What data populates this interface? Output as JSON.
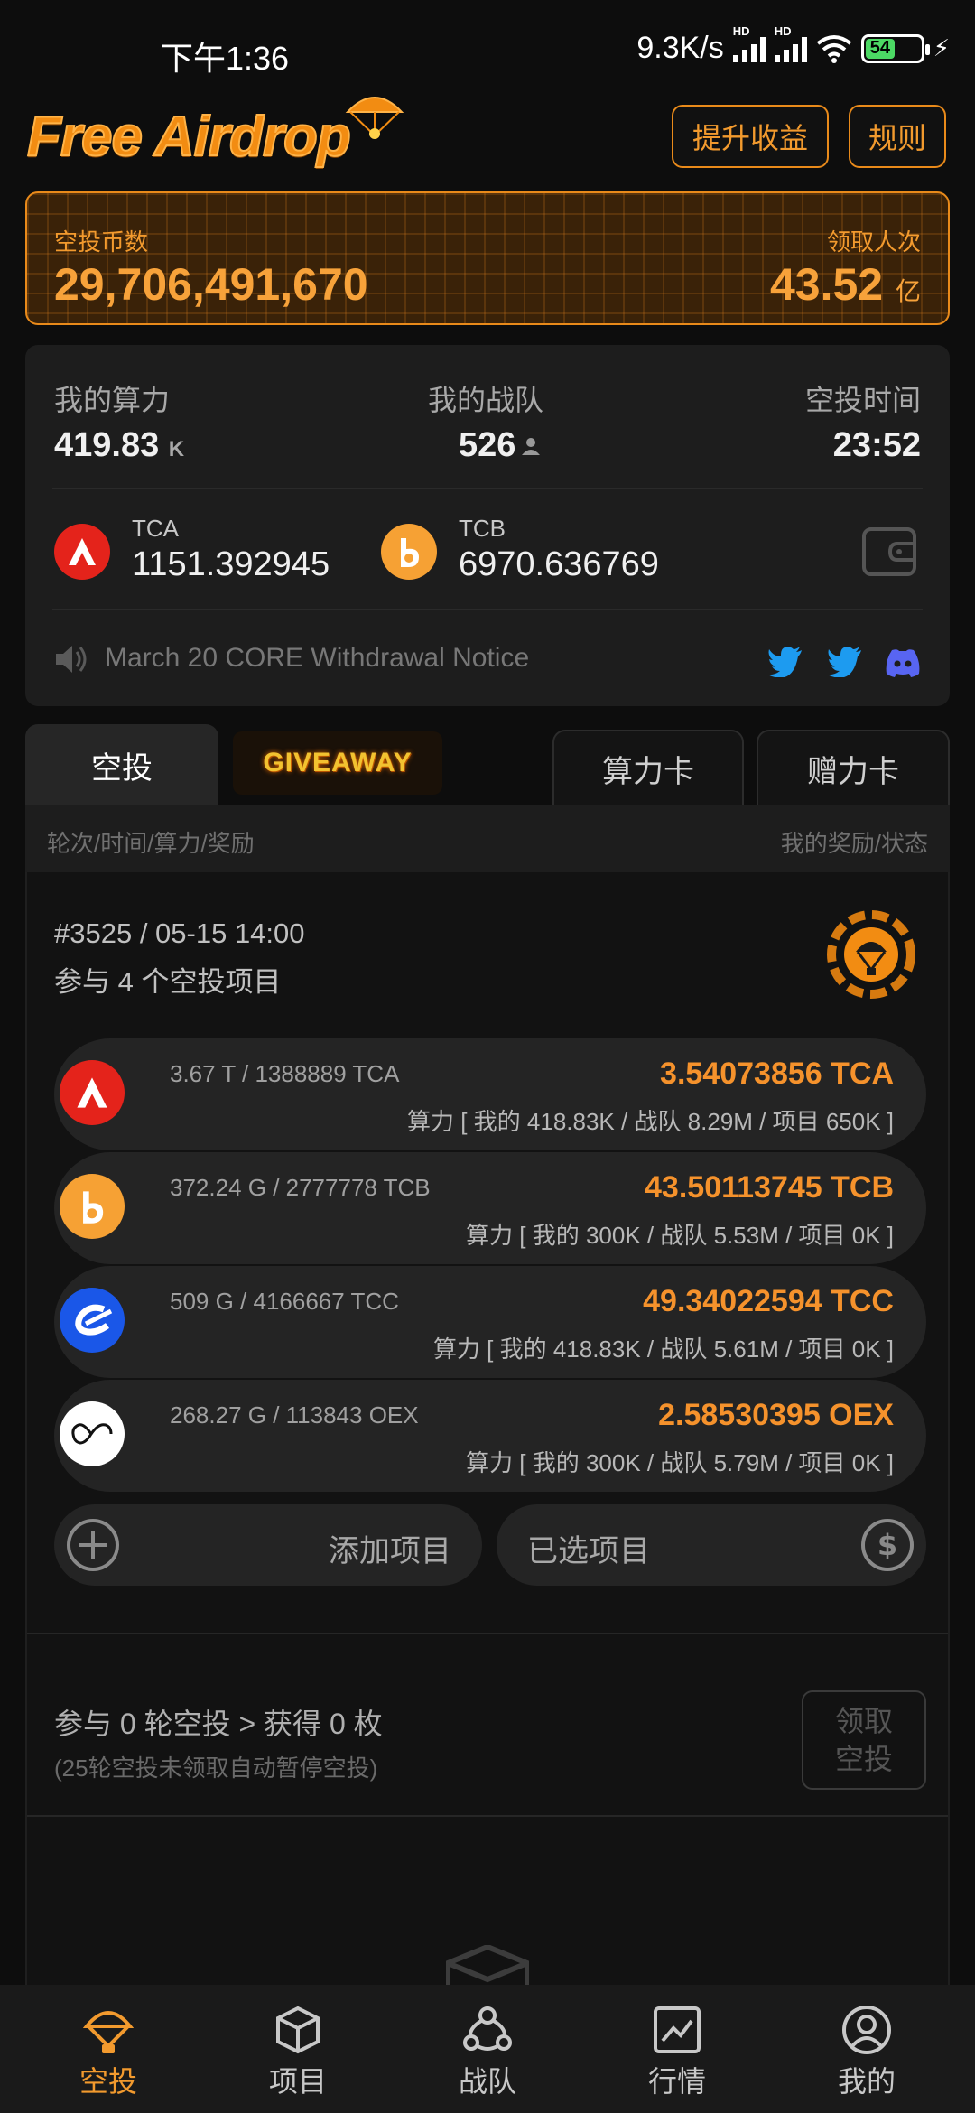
{
  "status": {
    "time": "下午1:36",
    "net_speed": "9.3K/s",
    "hd1": "HD",
    "hd2": "HD",
    "battery": "54",
    "battery_level": 0.54
  },
  "header": {
    "logo": "Free Airdrop",
    "boost_label": "提升收益",
    "rules_label": "规则"
  },
  "banner": {
    "coins_label": "空投币数",
    "coins_value": "29,706,491,670",
    "claims_label": "领取人次",
    "claims_value": "43.52",
    "claims_unit": "亿"
  },
  "stats": {
    "power_label": "我的算力",
    "power_value": "419.83",
    "power_unit": "K",
    "team_label": "我的战队",
    "team_value": "526",
    "time_label": "空投时间",
    "time_value": "23:52"
  },
  "wallet": [
    {
      "name": "TCA",
      "balance": "1151.392945"
    },
    {
      "name": "TCB",
      "balance": "6970.636769"
    }
  ],
  "notice": {
    "text": "March 20 CORE Withdrawal Notice"
  },
  "tabs": {
    "airdrop": "空投",
    "giveaway": "GIVEAWAY",
    "power_card": "算力卡",
    "gift_card": "赠力卡"
  },
  "subhead": {
    "left": "轮次/时间/算力/奖励",
    "right": "我的奖励/状态"
  },
  "round": {
    "title": "#3525 / 05-15 14:00",
    "subtitle": "参与 4 个空投项目",
    "projects": [
      {
        "amount": "3.67 T / 1388889 TCA",
        "reward": "3.54073856 TCA",
        "power": "算力 [ 我的 418.83K / 战队 8.29M / 项目 650K ]"
      },
      {
        "amount": "372.24 G / 2777778 TCB",
        "reward": "43.50113745 TCB",
        "power": "算力 [ 我的 300K / 战队 5.53M / 项目 0K ]"
      },
      {
        "amount": "509 G / 4166667 TCC",
        "reward": "49.34022594 TCC",
        "power": "算力 [ 我的 418.83K / 战队 5.61M / 项目 0K ]"
      },
      {
        "amount": "268.27 G / 113843 OEX",
        "reward": "2.58530395 OEX",
        "power": "算力 [ 我的 300K / 战队 5.79M / 项目 0K ]"
      }
    ],
    "add_project": "添加项目",
    "selected_project": "已选项目"
  },
  "claim": {
    "summary": "参与 0 轮空投 > 获得 0 枚",
    "hint": "(25轮空投未领取自动暂停空投)",
    "button_line1": "领取",
    "button_line2": "空投"
  },
  "nav": [
    {
      "label": "空投",
      "icon": "parachute-icon"
    },
    {
      "label": "项目",
      "icon": "cube-icon"
    },
    {
      "label": "战队",
      "icon": "team-icon"
    },
    {
      "label": "行情",
      "icon": "chart-icon"
    },
    {
      "label": "我的",
      "icon": "user-icon"
    }
  ],
  "colors": {
    "accent": "#f29a2e",
    "background": "#0d0d0d",
    "card": "#1d1d1d",
    "twitter": "#1d9bf0",
    "discord": "#5865f2"
  }
}
